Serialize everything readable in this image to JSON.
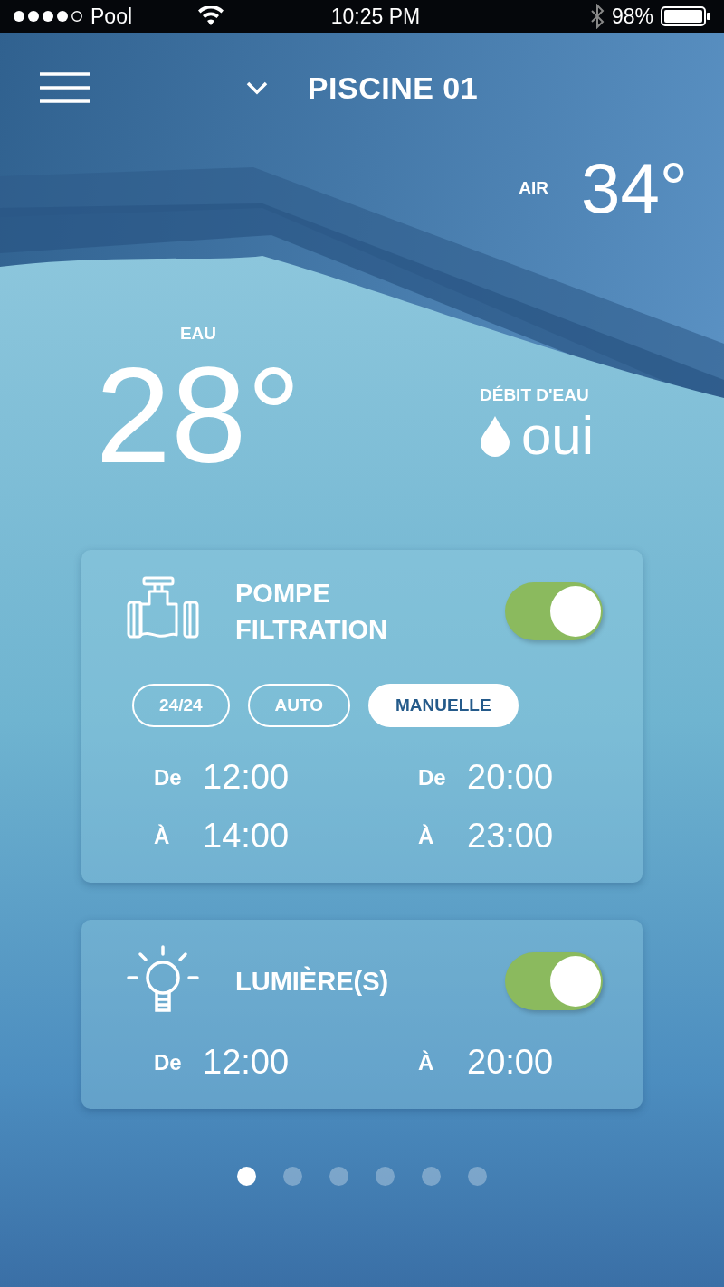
{
  "status_bar": {
    "carrier": "Pool",
    "time": "10:25 PM",
    "battery": "98%"
  },
  "header": {
    "title": "PISCINE 01"
  },
  "air": {
    "label": "AIR",
    "value": "34°"
  },
  "water": {
    "label": "EAU",
    "value": "28°"
  },
  "flow": {
    "label": "DÉBIT D'EAU",
    "value": "oui"
  },
  "devices": [
    {
      "kind": "pump",
      "title": "POMPE FILTRATION",
      "on": true,
      "modes": [
        {
          "label": "24/24",
          "selected": false
        },
        {
          "label": "AUTO",
          "selected": false
        },
        {
          "label": "MANUELLE",
          "selected": true
        }
      ],
      "slots": [
        {
          "label": "De",
          "time": "12:00"
        },
        {
          "label": "De",
          "time": "20:00"
        },
        {
          "label": "À",
          "time": "14:00"
        },
        {
          "label": "À",
          "time": "23:00"
        }
      ]
    },
    {
      "kind": "light",
      "title": "LUMIÈRE(S)",
      "on": true,
      "slots": [
        {
          "label": "De",
          "time": "12:00"
        },
        {
          "label": "À",
          "time": "20:00"
        }
      ]
    }
  ],
  "pages": [
    {
      "selected": true
    },
    {
      "selected": false
    },
    {
      "selected": false
    },
    {
      "selected": false
    },
    {
      "selected": false
    },
    {
      "selected": false
    }
  ]
}
